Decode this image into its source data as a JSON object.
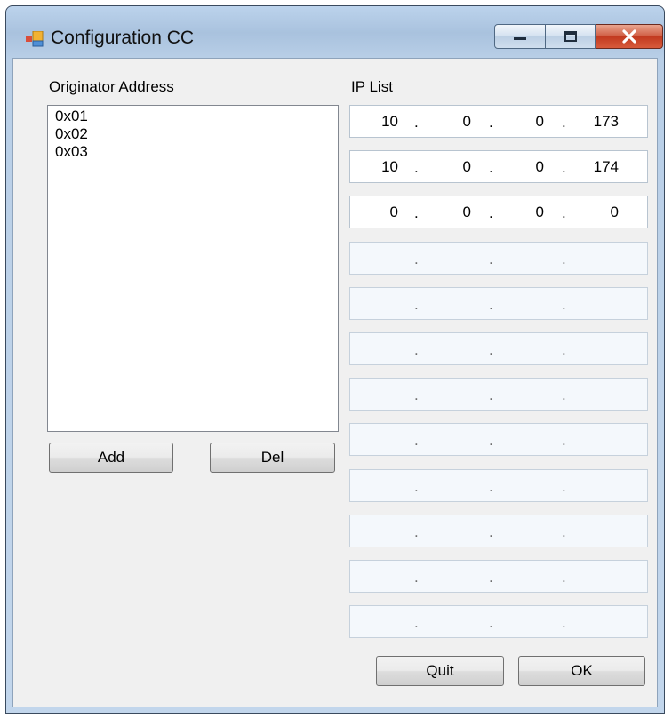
{
  "window": {
    "title": "Configuration CC",
    "icon": "app-form-icon",
    "controls": [
      "minimize-icon",
      "maximize-icon",
      "close-icon"
    ]
  },
  "originator": {
    "label": "Originator Address",
    "items": [
      "0x01",
      "0x02",
      "0x03"
    ],
    "add_label": "Add",
    "del_label": "Del"
  },
  "ip_list": {
    "label": "IP List",
    "separator": ".",
    "entries": [
      {
        "octets": [
          "10",
          "0",
          "0",
          "173"
        ],
        "enabled": true
      },
      {
        "octets": [
          "10",
          "0",
          "0",
          "174"
        ],
        "enabled": true
      },
      {
        "octets": [
          "0",
          "0",
          "0",
          "0"
        ],
        "enabled": true
      },
      {
        "octets": [
          "",
          "",
          "",
          ""
        ],
        "enabled": false
      },
      {
        "octets": [
          "",
          "",
          "",
          ""
        ],
        "enabled": false
      },
      {
        "octets": [
          "",
          "",
          "",
          ""
        ],
        "enabled": false
      },
      {
        "octets": [
          "",
          "",
          "",
          ""
        ],
        "enabled": false
      },
      {
        "octets": [
          "",
          "",
          "",
          ""
        ],
        "enabled": false
      },
      {
        "octets": [
          "",
          "",
          "",
          ""
        ],
        "enabled": false
      },
      {
        "octets": [
          "",
          "",
          "",
          ""
        ],
        "enabled": false
      },
      {
        "octets": [
          "",
          "",
          "",
          ""
        ],
        "enabled": false
      },
      {
        "octets": [
          "",
          "",
          "",
          ""
        ],
        "enabled": false
      }
    ]
  },
  "actions": {
    "quit_label": "Quit",
    "ok_label": "OK"
  },
  "colors": {
    "titlebar": "#b9cfe7",
    "client_bg": "#f0f0f0",
    "close_button": "#c1391f"
  }
}
